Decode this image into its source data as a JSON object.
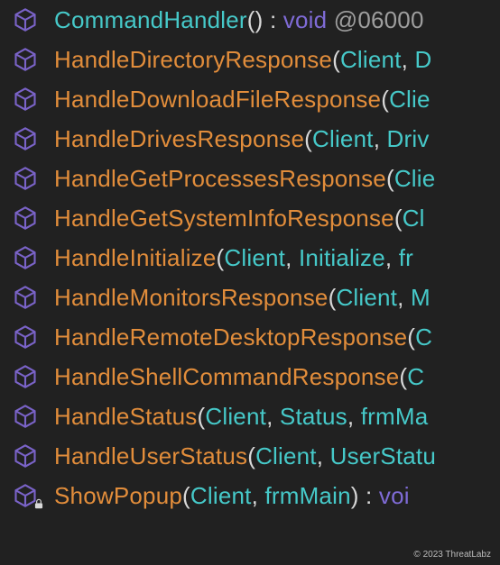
{
  "icon_color": "#7a63c8",
  "lock_color": "#d8d8d8",
  "items": [
    {
      "locked": false,
      "kind": "ctor",
      "segments": [
        {
          "text": "CommandHandler",
          "cls": "c-ctor"
        },
        {
          "text": "()",
          "cls": "c-punct"
        },
        {
          "text": " : ",
          "cls": "c-punct"
        },
        {
          "text": "void",
          "cls": "c-type"
        },
        {
          "text": " @0600",
          "cls": "c-dim"
        },
        {
          "text": "0",
          "cls": "c-dim"
        }
      ]
    },
    {
      "locked": false,
      "kind": "method",
      "segments": [
        {
          "text": "HandleDirectoryResponse",
          "cls": "c-method"
        },
        {
          "text": "(",
          "cls": "c-punct"
        },
        {
          "text": "Client",
          "cls": "c-param"
        },
        {
          "text": ", ",
          "cls": "c-punct"
        },
        {
          "text": "D",
          "cls": "c-param2"
        }
      ]
    },
    {
      "locked": false,
      "kind": "method",
      "segments": [
        {
          "text": "HandleDownloadFileResponse",
          "cls": "c-method"
        },
        {
          "text": "(",
          "cls": "c-punct"
        },
        {
          "text": "Clie",
          "cls": "c-param"
        }
      ]
    },
    {
      "locked": false,
      "kind": "method",
      "segments": [
        {
          "text": "HandleDrivesResponse",
          "cls": "c-method"
        },
        {
          "text": "(",
          "cls": "c-punct"
        },
        {
          "text": "Client",
          "cls": "c-param"
        },
        {
          "text": ", ",
          "cls": "c-punct"
        },
        {
          "text": "Driv",
          "cls": "c-param2"
        }
      ]
    },
    {
      "locked": false,
      "kind": "method",
      "segments": [
        {
          "text": "HandleGetProcessesResponse",
          "cls": "c-method"
        },
        {
          "text": "(",
          "cls": "c-punct"
        },
        {
          "text": "Clie",
          "cls": "c-param"
        }
      ]
    },
    {
      "locked": false,
      "kind": "method",
      "segments": [
        {
          "text": "HandleGetSystemInfoResponse",
          "cls": "c-method"
        },
        {
          "text": "(",
          "cls": "c-punct"
        },
        {
          "text": "Cl",
          "cls": "c-param"
        }
      ]
    },
    {
      "locked": false,
      "kind": "method",
      "segments": [
        {
          "text": "HandleInitialize",
          "cls": "c-method"
        },
        {
          "text": "(",
          "cls": "c-punct"
        },
        {
          "text": "Client",
          "cls": "c-param"
        },
        {
          "text": ", ",
          "cls": "c-punct"
        },
        {
          "text": "Initialize",
          "cls": "c-param2"
        },
        {
          "text": ", ",
          "cls": "c-punct"
        },
        {
          "text": "fr",
          "cls": "c-param2"
        }
      ]
    },
    {
      "locked": false,
      "kind": "method",
      "segments": [
        {
          "text": "HandleMonitorsResponse",
          "cls": "c-method"
        },
        {
          "text": "(",
          "cls": "c-punct"
        },
        {
          "text": "Client",
          "cls": "c-param"
        },
        {
          "text": ", ",
          "cls": "c-punct"
        },
        {
          "text": "M",
          "cls": "c-param2"
        }
      ]
    },
    {
      "locked": false,
      "kind": "method",
      "segments": [
        {
          "text": "HandleRemoteDesktopResponse",
          "cls": "c-method"
        },
        {
          "text": "(",
          "cls": "c-punct"
        },
        {
          "text": "C",
          "cls": "c-param"
        }
      ]
    },
    {
      "locked": false,
      "kind": "method",
      "segments": [
        {
          "text": "HandleShellCommandResponse",
          "cls": "c-method"
        },
        {
          "text": "(",
          "cls": "c-punct"
        },
        {
          "text": "C",
          "cls": "c-param"
        }
      ]
    },
    {
      "locked": false,
      "kind": "method",
      "segments": [
        {
          "text": "HandleStatus",
          "cls": "c-method"
        },
        {
          "text": "(",
          "cls": "c-punct"
        },
        {
          "text": "Client",
          "cls": "c-param"
        },
        {
          "text": ", ",
          "cls": "c-punct"
        },
        {
          "text": "Status",
          "cls": "c-param2"
        },
        {
          "text": ", ",
          "cls": "c-punct"
        },
        {
          "text": "frmMa",
          "cls": "c-param2"
        }
      ]
    },
    {
      "locked": false,
      "kind": "method",
      "segments": [
        {
          "text": "HandleUserStatus",
          "cls": "c-method"
        },
        {
          "text": "(",
          "cls": "c-punct"
        },
        {
          "text": "Client",
          "cls": "c-param"
        },
        {
          "text": ", ",
          "cls": "c-punct"
        },
        {
          "text": "UserStatu",
          "cls": "c-param2"
        }
      ]
    },
    {
      "locked": true,
      "kind": "method",
      "segments": [
        {
          "text": "ShowPopup",
          "cls": "c-method"
        },
        {
          "text": "(",
          "cls": "c-punct"
        },
        {
          "text": "Client",
          "cls": "c-param"
        },
        {
          "text": ", ",
          "cls": "c-punct"
        },
        {
          "text": "frmMain",
          "cls": "c-param2"
        },
        {
          "text": ")",
          "cls": "c-punct"
        },
        {
          "text": " : ",
          "cls": "c-punct"
        },
        {
          "text": "voi",
          "cls": "c-type"
        }
      ]
    }
  ],
  "watermark": "© 2023 ThreatLabz"
}
